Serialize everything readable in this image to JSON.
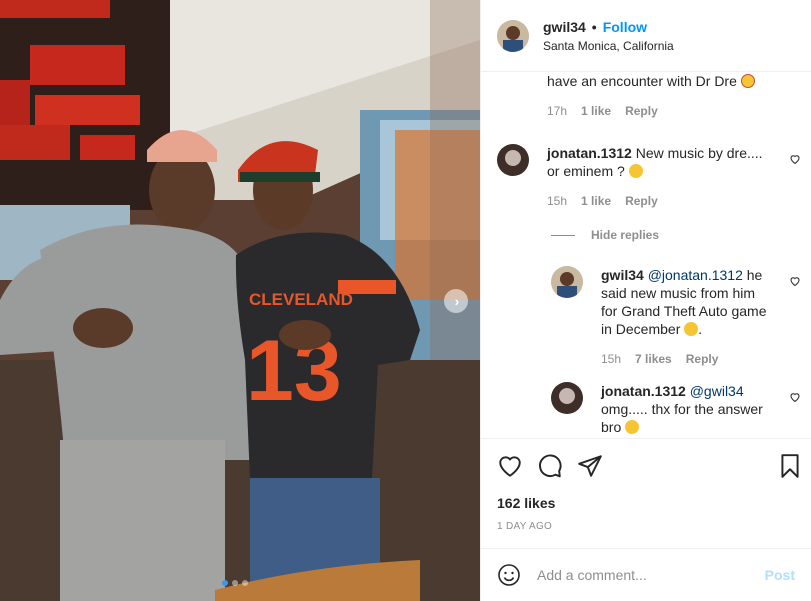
{
  "post": {
    "username": "gwil34",
    "separator": "•",
    "follow_label": "Follow",
    "location": "Santa Monica, California",
    "photo_alt": "gwil34 photo",
    "carousel": {
      "count": 3,
      "active_index": 0
    }
  },
  "comments": [
    {
      "id": "c0",
      "text": "have an encounter with Dr Dre",
      "emoji": "star-struck",
      "time": "17h",
      "likes": "1 like",
      "reply_label": "Reply"
    },
    {
      "id": "c1",
      "username": "jonatan.1312",
      "text": "New music by dre.... or eminem ?",
      "emoji": "surprised",
      "time": "15h",
      "likes": "1 like",
      "reply_label": "Reply"
    }
  ],
  "hide_replies_label": "Hide replies",
  "replies": [
    {
      "id": "r0",
      "username": "gwil34",
      "mention": "@jonatan.1312",
      "text": "he said new music from him for Grand Theft Auto game in December",
      "emoji": "shocked-hands",
      "time": "15h",
      "likes": "7 likes",
      "reply_label": "Reply"
    },
    {
      "id": "r1",
      "username": "jonatan.1312",
      "mention": "@gwil34",
      "text": "omg..... thx for the answer bro",
      "emoji": "shocked-hands",
      "likes": ""
    }
  ],
  "actions": {
    "likes_label": "162 likes",
    "date_label": "1 DAY AGO",
    "icons": [
      "heart-icon",
      "comment-icon",
      "share-icon",
      "bookmark-icon"
    ]
  },
  "add_comment": {
    "placeholder": "Add a comment...",
    "post_label": "Post"
  },
  "colors": {
    "link": "#0095f6",
    "mention": "#00376b",
    "secondary": "#8e8e8e",
    "post_disabled": "#b2dffc"
  }
}
